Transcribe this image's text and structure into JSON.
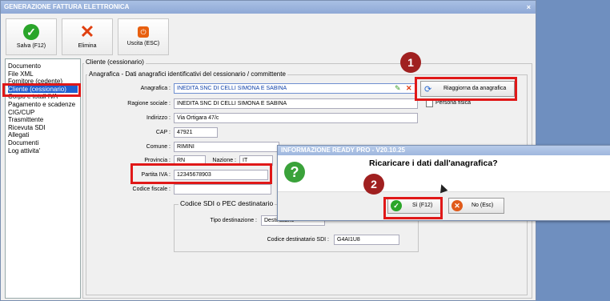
{
  "window": {
    "title": "GENERAZIONE FATTURA ELETTRONICA",
    "close": "×"
  },
  "toolbar": {
    "save": "Salva (F12)",
    "delete": "Elimina",
    "exit": "Uscita (ESC)"
  },
  "sidebar": {
    "items": [
      {
        "label": "Documento",
        "selected": false
      },
      {
        "label": "File XML",
        "selected": false
      },
      {
        "label": "Fornitore (cedente)",
        "selected": false
      },
      {
        "label": "Cliente (cessionario)",
        "selected": true
      },
      {
        "label": "Corpo e totali IVA",
        "selected": false
      },
      {
        "label": "Pagamento e scadenze",
        "selected": false
      },
      {
        "label": "CIG/CUP",
        "selected": false
      },
      {
        "label": "Trasmittente",
        "selected": false
      },
      {
        "label": "Ricevuta SDI",
        "selected": false
      },
      {
        "label": "Allegati",
        "selected": false
      },
      {
        "label": "Documenti",
        "selected": false
      },
      {
        "label": "Log attivita'",
        "selected": false
      }
    ]
  },
  "client": {
    "group_title": "Cliente (cessionario)",
    "section_title": "Anagrafica - Dati anagrafici identificativi del cessionario / committente",
    "fields": {
      "anagrafica": {
        "label": "Anagrafica :",
        "value": "INEDITA SNC DI CELLI SIMONA E SABINA"
      },
      "ragione": {
        "label": "Ragione sociale :",
        "value": "INEDITA SNC DI CELLI SIMONA E SABINA"
      },
      "indirizzo": {
        "label": "Indirizzo :",
        "value": "Via Ortigara 47/c"
      },
      "cap": {
        "label": "CAP :",
        "value": "47921"
      },
      "comune": {
        "label": "Comune :",
        "value": "RIMINI"
      },
      "provincia": {
        "label": "Provincia :",
        "value": "RN"
      },
      "nazione": {
        "label": "Nazione :",
        "value": "IT"
      },
      "piva": {
        "label": "Partita IVA :",
        "value": "12345678903"
      },
      "cf": {
        "label": "Codice fiscale :",
        "value": ""
      }
    },
    "reload_button": "Riaggiorna da anagrafica",
    "persona_fisica": "Persona fisica"
  },
  "sdi": {
    "title": "Codice SDI o PEC destinatario",
    "tipo_label": "Tipo destinazione :",
    "tipo_value": "Destinatario",
    "codice_label": "Codice destinatario SDI :",
    "codice_value": "G4AI1U8"
  },
  "dialog": {
    "title": "INFORMAZIONE READY PRO - V20.10.25",
    "message": "Ricaricare i dati dall'anagrafica?",
    "yes": "Sì (F12)",
    "no": "No (Esc)"
  },
  "annotations": {
    "step1": "1",
    "step2": "2"
  },
  "colors": {
    "highlight": "#e01818",
    "selection": "#1e5fd0",
    "badge": "#a02020"
  }
}
